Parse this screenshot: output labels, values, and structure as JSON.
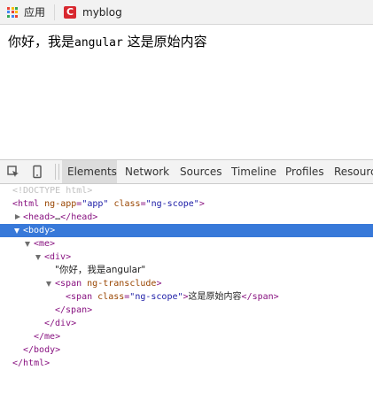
{
  "bookmarks": {
    "apps_label": "应用",
    "blog_label": "myblog",
    "blog_icon_letter": "C",
    "apps_colors": [
      "#e94235",
      "#fbbc04",
      "#34a853",
      "#4285f4",
      "#e94235",
      "#fbbc04",
      "#34a853",
      "#4285f4",
      "#e94235"
    ]
  },
  "page": {
    "text_cn1": "你好，我是",
    "text_en": "angular",
    "text_cn2": " 这是原始内容"
  },
  "devtools": {
    "tabs": [
      "Elements",
      "Network",
      "Sources",
      "Timeline",
      "Profiles",
      "Resources"
    ],
    "active_tab": "Elements",
    "dom": {
      "doctype": "<!DOCTYPE html>",
      "html_tag": "html",
      "html_attr1": "ng-app",
      "html_val1": "\"app\"",
      "html_attr2": "class",
      "html_val2": "\"ng-scope\"",
      "head_open": "<head>",
      "head_ellipsis": "…",
      "head_close": "</head>",
      "body_open": "<body>",
      "me_open": "<me>",
      "div_open": "<div>",
      "div_text": "\"你好，我是angular\"",
      "span_open_tag": "span",
      "span_attr": "ng-transclude",
      "inner_span_tag": "span",
      "inner_span_attr": "class",
      "inner_span_val": "\"ng-scope\"",
      "inner_span_text": "这是原始内容",
      "inner_span_close": "</span>",
      "span_close": "</span>",
      "div_close": "</div>",
      "me_close": "</me>",
      "body_close": "</body>",
      "html_close": "</html>"
    },
    "selection_color": "#3879d9"
  }
}
